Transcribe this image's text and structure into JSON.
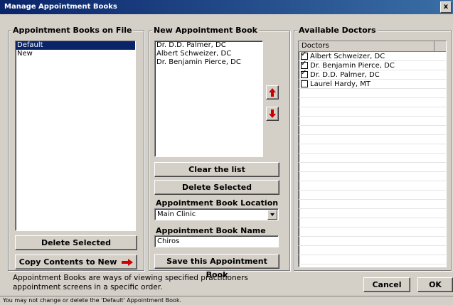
{
  "window": {
    "title": "Manage Appointment Books",
    "close_label": "x"
  },
  "books_on_file": {
    "legend": "Appointment Books on File",
    "items": [
      {
        "label": "Default",
        "selected": true
      },
      {
        "label": "New",
        "selected": false
      }
    ],
    "delete_label": "Delete Selected",
    "copy_label": "Copy Contents to New"
  },
  "new_book": {
    "legend": "New Appointment Book",
    "items": [
      "Dr. D.D. Palmer, DC",
      "Albert Schweizer, DC",
      "Dr. Benjamin Pierce, DC"
    ],
    "clear_label": "Clear the list",
    "delete_label": "Delete Selected",
    "location_label": "Appointment Book Location",
    "location_value": "Main Clinic",
    "name_label": "Appointment Book Name",
    "name_value": "Chiros",
    "save_label": "Save this Appointment Book",
    "move_up_icon": "red-up-arrow-icon",
    "move_down_icon": "red-down-arrow-icon"
  },
  "doctors": {
    "legend": "Available Doctors",
    "column_header": "Doctors",
    "items": [
      {
        "label": "Albert Schweizer, DC",
        "checked": true
      },
      {
        "label": "Dr. Benjamin Pierce, DC",
        "checked": true
      },
      {
        "label": "Dr. D.D. Palmer, DC",
        "checked": true
      },
      {
        "label": "Laurel Hardy, MT",
        "checked": false
      }
    ]
  },
  "footer": {
    "description": "Appointment Books are ways of viewing specified practitioners appointment screens in a specific order.",
    "cancel_label": "Cancel",
    "ok_label": "OK",
    "status": "You may not change or delete the 'Default' Appointment Book."
  },
  "colors": {
    "title_bar": "#0a246a",
    "selection": "#0a246a",
    "arrow": "#cc0000",
    "face": "#d4d0c8"
  }
}
